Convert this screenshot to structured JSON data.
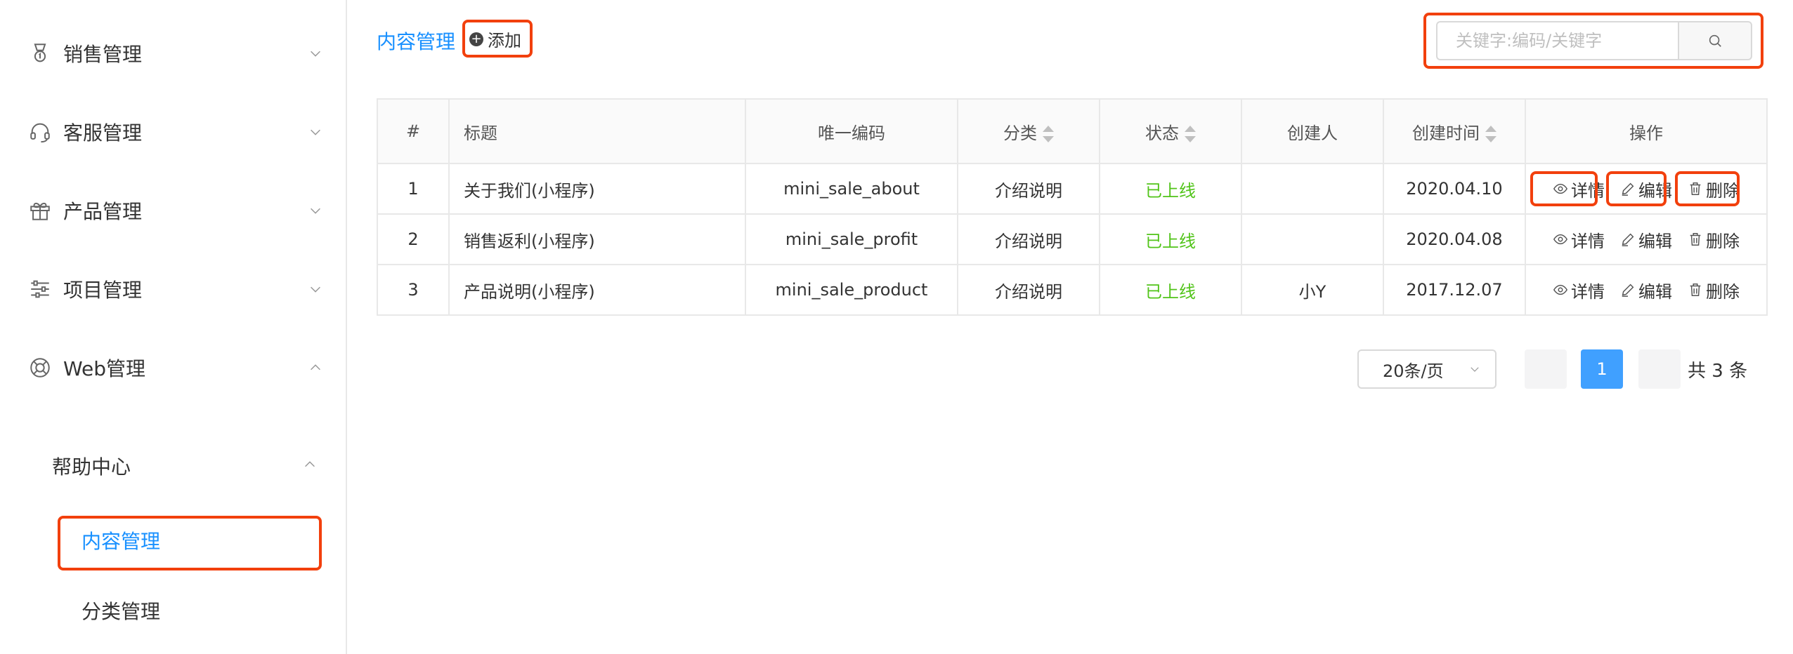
{
  "sidebar": {
    "items": [
      {
        "label": "销售管理",
        "icon": "medal-icon",
        "expanded": false
      },
      {
        "label": "客服管理",
        "icon": "headset-icon",
        "expanded": false
      },
      {
        "label": "产品管理",
        "icon": "gift-icon",
        "expanded": false
      },
      {
        "label": "项目管理",
        "icon": "sliders-icon",
        "expanded": false
      },
      {
        "label": "Web管理",
        "icon": "lifebuoy-icon",
        "expanded": true
      }
    ],
    "submenu": {
      "label": "帮助中心",
      "expanded": true,
      "children": [
        {
          "label": "内容管理",
          "active": true
        },
        {
          "label": "分类管理",
          "active": false
        }
      ]
    }
  },
  "header": {
    "title": "内容管理",
    "add_label": "添加",
    "search_placeholder": "关键字:编码/关键字"
  },
  "table": {
    "columns": [
      "#",
      "标题",
      "唯一编码",
      "分类",
      "状态",
      "创建人",
      "创建时间",
      "操作"
    ],
    "sortable_columns": [
      "分类",
      "状态",
      "创建时间"
    ],
    "rows": [
      {
        "index": "1",
        "title": "关于我们(小程序)",
        "code": "mini_sale_about",
        "category": "介绍说明",
        "status": "已上线",
        "creator": "",
        "created": "2020.04.10"
      },
      {
        "index": "2",
        "title": "销售返利(小程序)",
        "code": "mini_sale_profit",
        "category": "介绍说明",
        "status": "已上线",
        "creator": "",
        "created": "2020.04.08"
      },
      {
        "index": "3",
        "title": "产品说明(小程序)",
        "code": "mini_sale_product",
        "category": "介绍说明",
        "status": "已上线",
        "creator": "小Y",
        "created": "2017.12.07"
      }
    ],
    "actions": {
      "detail": "详情",
      "edit": "编辑",
      "delete": "删除"
    }
  },
  "pagination": {
    "page_size": "20条/页",
    "current_page": "1",
    "total": "共 3 条"
  },
  "colors": {
    "accent": "#1890ff",
    "online": "#52c41a",
    "highlight": "#f2400d"
  }
}
